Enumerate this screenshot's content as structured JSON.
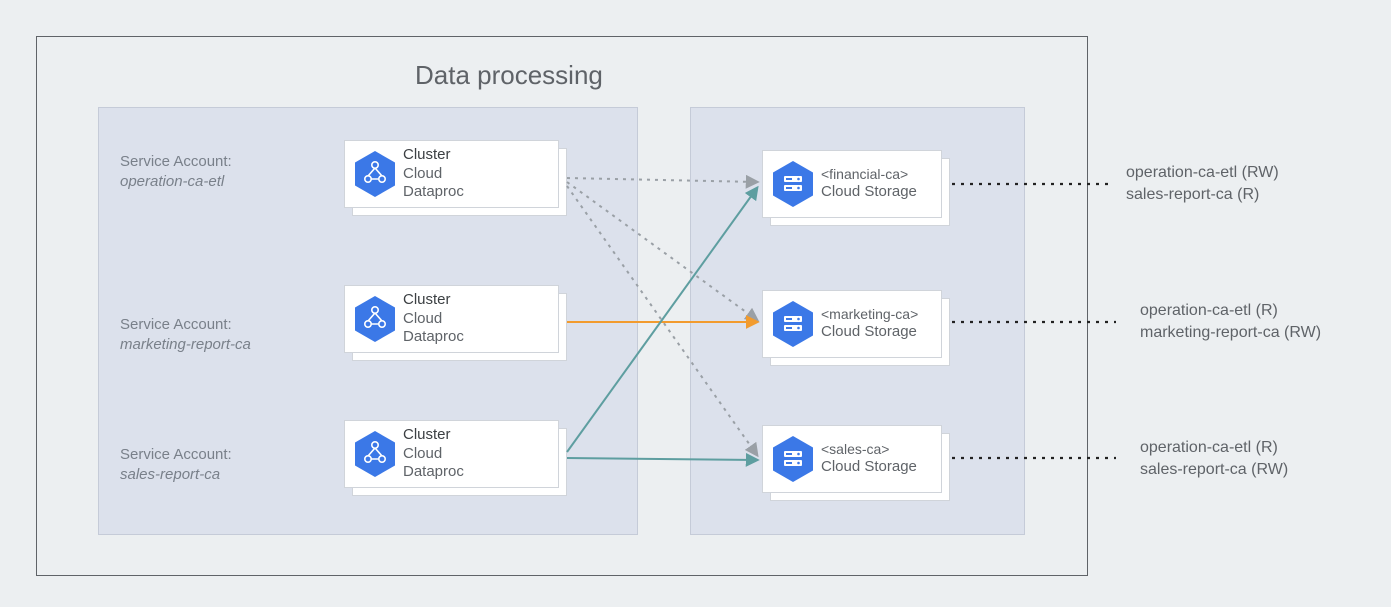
{
  "title": "Data processing",
  "svc_label": "Service Account:",
  "service_accounts": {
    "a": "operation-ca-etl",
    "b": "marketing-report-ca",
    "c": "sales-report-ca"
  },
  "cluster": {
    "title": "Cluster",
    "sub1": "Cloud",
    "sub2": "Dataproc"
  },
  "buckets": {
    "a": {
      "name": "<financial-ca>",
      "sub": "Cloud Storage"
    },
    "b": {
      "name": "<marketing-ca>",
      "sub": "Cloud Storage"
    },
    "c": {
      "name": "<sales-ca>",
      "sub": "Cloud Storage"
    }
  },
  "perms": {
    "a1": "operation-ca-etl (RW)",
    "a2": "sales-report-ca (R)",
    "b1": "operation-ca-etl (R)",
    "b2": "marketing-report-ca (RW)",
    "c1": "operation-ca-etl (R)",
    "c2": "sales-report-ca (RW)"
  },
  "colors": {
    "grey": "#9aa0a6",
    "teal": "#5e9ea0",
    "orange": "#f29b2e",
    "blue": "#3b78e7"
  }
}
